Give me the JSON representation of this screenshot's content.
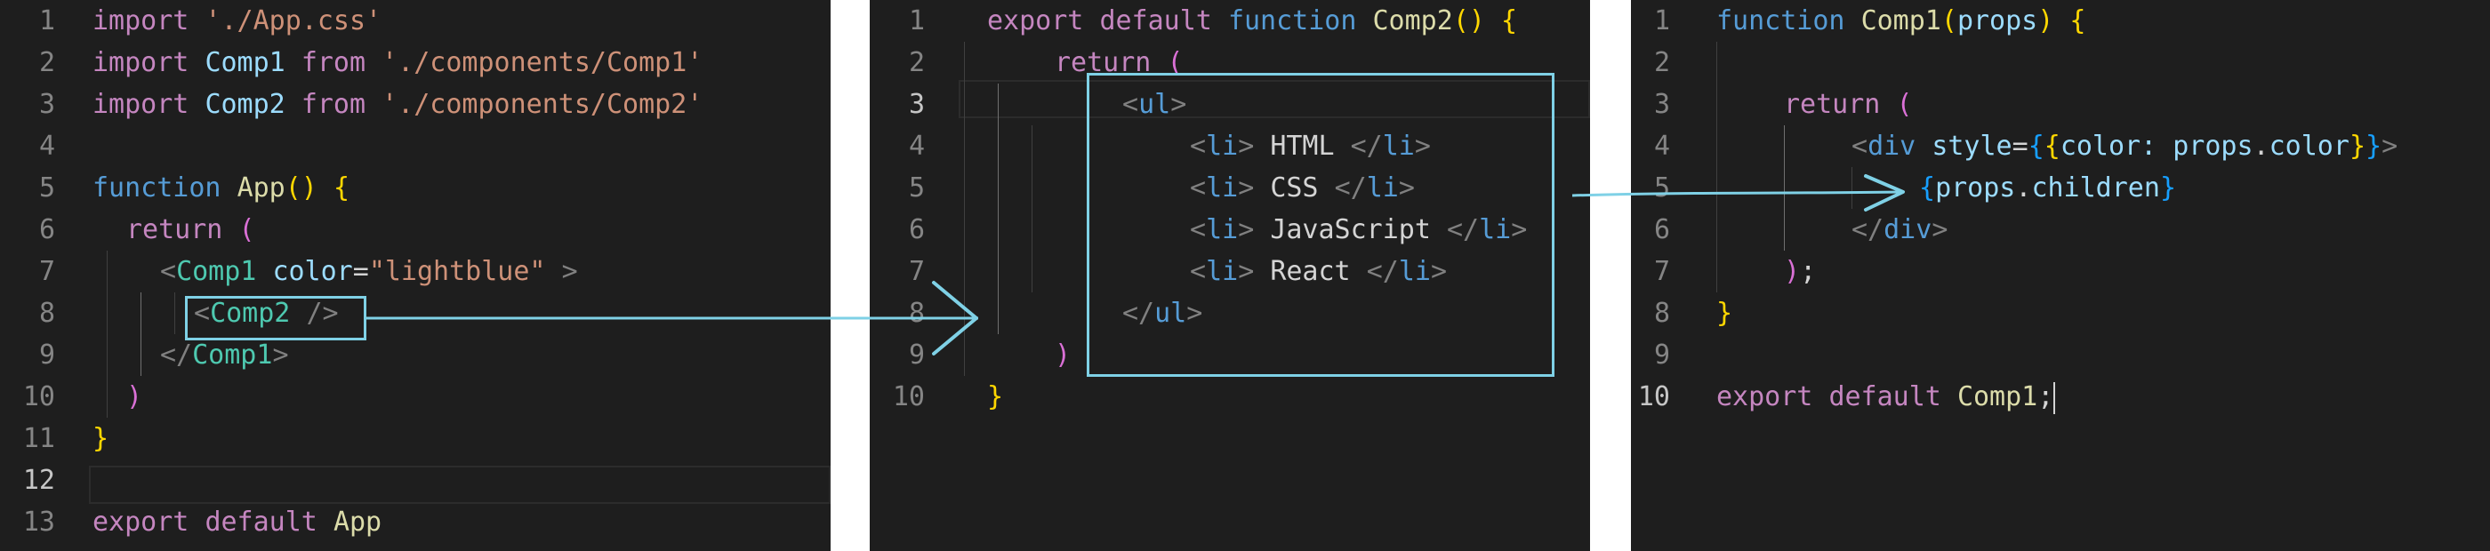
{
  "panel1": {
    "line_numbers": [
      "1",
      "2",
      "3",
      "4",
      "5",
      "6",
      "7",
      "8",
      "9",
      "10",
      "11",
      "12",
      "13"
    ],
    "l1": {
      "kw": "import",
      "str": "'./App.css'"
    },
    "l2": {
      "kw": "import",
      "name": "Comp1",
      "from": "from",
      "str": "'./components/Comp1'"
    },
    "l3": {
      "kw": "import",
      "name": "Comp2",
      "from": "from",
      "str": "'./components/Comp2'"
    },
    "l5": {
      "kw": "function",
      "name": "App",
      "parens": "()",
      "brace": "{"
    },
    "l6": {
      "kw": "return",
      "paren": "("
    },
    "l7": {
      "open": "<",
      "tag": "Comp1",
      "attr": "color",
      "eq": "=",
      "val": "\"lightblue\"",
      "close": ">"
    },
    "l8": {
      "open": "<",
      "tag": "Comp2",
      "close": "/>"
    },
    "l9": {
      "open": "</",
      "tag": "Comp1",
      "close": ">"
    },
    "l10": {
      "paren": ")"
    },
    "l11": {
      "brace": "}"
    },
    "l13": {
      "kw1": "export",
      "kw2": "default",
      "name": "App"
    }
  },
  "panel2": {
    "line_numbers": [
      "1",
      "2",
      "3",
      "4",
      "5",
      "6",
      "7",
      "8",
      "9",
      "10"
    ],
    "l1": {
      "kw1": "export",
      "kw2": "default",
      "kw3": "function",
      "name": "Comp2",
      "parens": "()",
      "brace": "{"
    },
    "l2": {
      "kw": "return",
      "paren": "("
    },
    "l3": {
      "open": "<",
      "tag": "ul",
      "close": ">"
    },
    "items": [
      "HTML",
      "CSS",
      "JavaScript",
      "React"
    ],
    "li_open_lt": "<",
    "li_tag": "li",
    "li_open_gt": ">",
    "li_close_lt": "</",
    "li_close_gt": ">",
    "l8": {
      "open": "</",
      "tag": "ul",
      "close": ">"
    },
    "l9": {
      "paren": ")"
    },
    "l10": {
      "brace": "}"
    }
  },
  "panel3": {
    "line_numbers": [
      "1",
      "2",
      "3",
      "4",
      "5",
      "6",
      "7",
      "8",
      "9",
      "10"
    ],
    "l1": {
      "kw": "function",
      "name": "Comp1",
      "paren_open": "(",
      "param": "props",
      "paren_close": ")",
      "brace": "{"
    },
    "l3": {
      "kw": "return",
      "paren": "("
    },
    "l4": {
      "open": "<",
      "tag": "div",
      "attr": "style",
      "eq": "=",
      "b1": "{",
      "b2": "{",
      "key": "color:",
      "obj": "props",
      "dot": ".",
      "prop": "color",
      "b3": "}",
      "b4": "}",
      "close": ">"
    },
    "l5": {
      "b1": "{",
      "obj": "props",
      "dot": ".",
      "prop": "children",
      "b2": "}"
    },
    "l6": {
      "open": "</",
      "tag": "div",
      "close": ">"
    },
    "l7": {
      "paren": ")",
      "semi": ";"
    },
    "l8": {
      "brace": "}"
    },
    "l10": {
      "kw1": "export",
      "kw2": "default",
      "name": "Comp1",
      "semi": ";"
    }
  },
  "colors": {
    "background": "#1e1e1e",
    "highlight_box": "#7fd1e6",
    "arrow": "#7fd1e6"
  },
  "icons": {
    "arrow_1": "arrow-right",
    "arrow_2": "arrow-right"
  }
}
